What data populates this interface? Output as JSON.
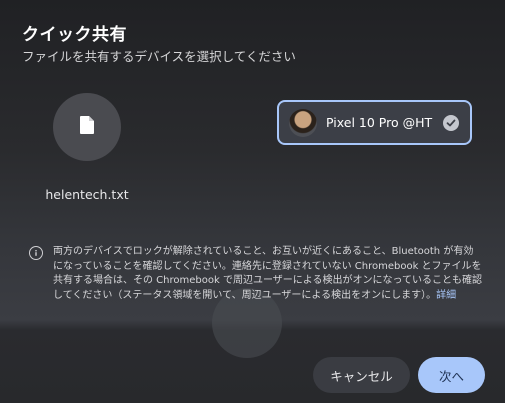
{
  "header": {
    "title": "クイック共有",
    "subtitle": "ファイルを共有するデバイスを選択してください"
  },
  "file": {
    "icon": "file-icon",
    "name": "helentech.txt"
  },
  "device": {
    "name": "Pixel 10 Pro @HT",
    "selected": true,
    "accent": "#a8c7fa"
  },
  "info": {
    "icon": "info-icon",
    "text": "両方のデバイスでロックが解除されていること、お互いが近くにあること、Bluetooth が有効になっていることを確認してください。連絡先に登録されていない Chromebook とファイルを共有する場合は、その Chromebook で周辺ユーザーによる検出がオンになっていることも確認してください（ステータス領域を開いて、周辺ユーザーによる検出をオンにします）。",
    "link": "詳細"
  },
  "buttons": {
    "cancel": "キャンセル",
    "next": "次へ"
  }
}
